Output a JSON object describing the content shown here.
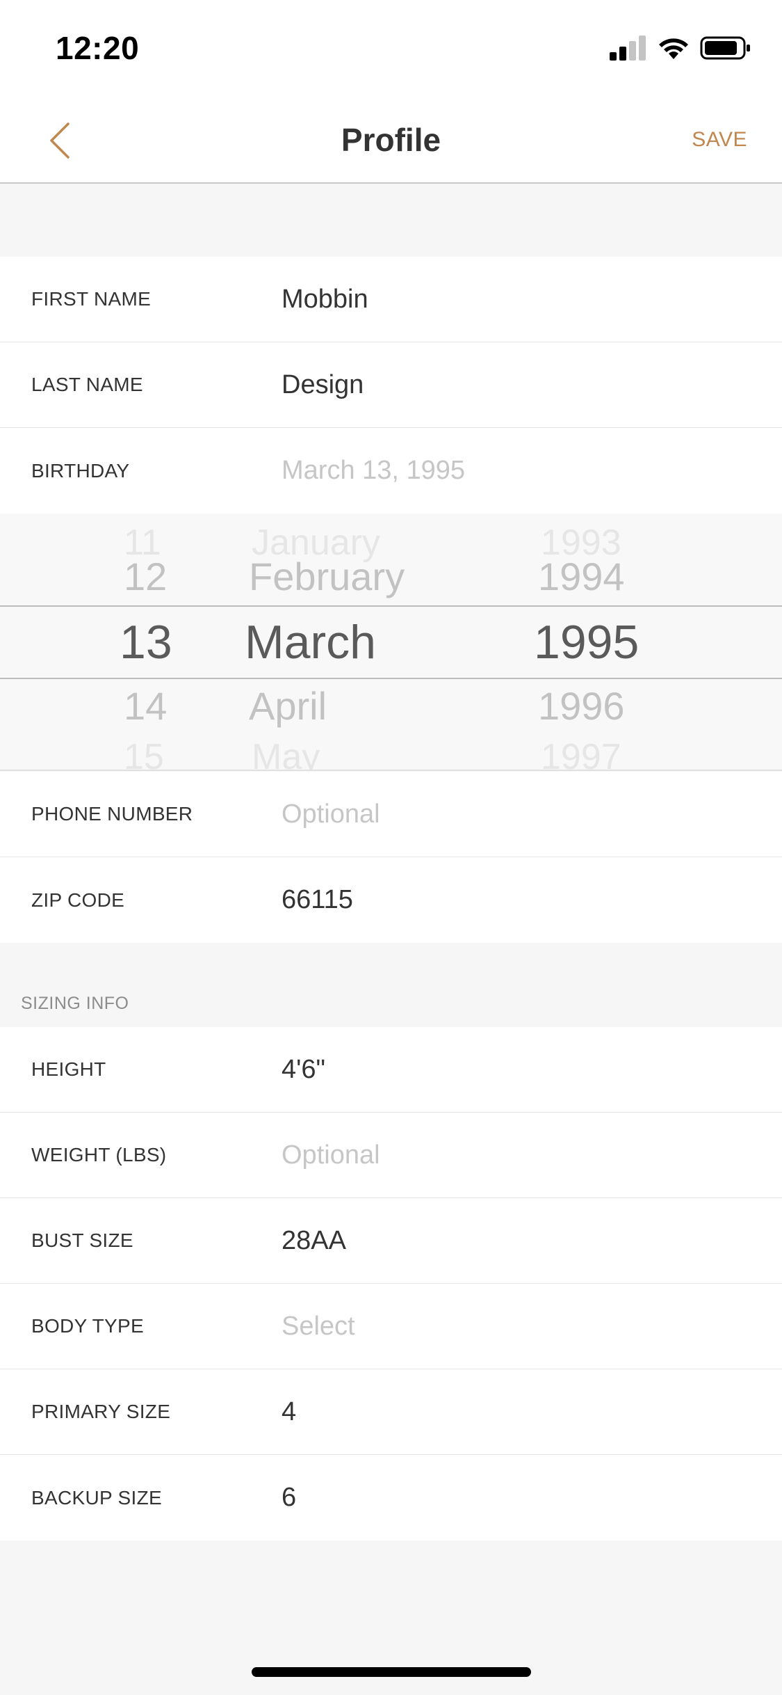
{
  "status_bar": {
    "time": "12:20"
  },
  "nav": {
    "title": "Profile",
    "save_label": "SAVE"
  },
  "profile": [
    {
      "label": "FIRST NAME",
      "value": "Mobbin",
      "placeholder": false
    },
    {
      "label": "LAST NAME",
      "value": "Design",
      "placeholder": false
    },
    {
      "label": "BIRTHDAY",
      "value": "March 13, 1995",
      "placeholder": true
    }
  ],
  "picker": {
    "days": [
      "11",
      "12",
      "13",
      "14",
      "15"
    ],
    "months": [
      "January",
      "February",
      "March",
      "April",
      "May"
    ],
    "years": [
      "1993",
      "1994",
      "1995",
      "1996",
      "1997"
    ],
    "selected": {
      "day": "13",
      "month": "March",
      "year": "1995"
    }
  },
  "contact": [
    {
      "label": "PHONE NUMBER",
      "value": "Optional",
      "placeholder": true
    },
    {
      "label": "ZIP CODE",
      "value": "66115",
      "placeholder": false
    }
  ],
  "sizing": {
    "header": "SIZING INFO",
    "rows": [
      {
        "label": "HEIGHT",
        "value": "4'6\"",
        "placeholder": false
      },
      {
        "label": "WEIGHT (LBS)",
        "value": "Optional",
        "placeholder": true
      },
      {
        "label": "BUST SIZE",
        "value": "28AA",
        "placeholder": false
      },
      {
        "label": "BODY TYPE",
        "value": "Select",
        "placeholder": true
      },
      {
        "label": "PRIMARY SIZE",
        "value": "4",
        "placeholder": false
      },
      {
        "label": "BACKUP SIZE",
        "value": "6",
        "placeholder": false
      }
    ]
  },
  "colors": {
    "accent": "#c0874f",
    "placeholder": "#c6c6c6",
    "background": "#f6f6f6"
  },
  "icons": [
    "signal-icon",
    "wifi-icon",
    "battery-icon",
    "back-chevron-icon"
  ]
}
